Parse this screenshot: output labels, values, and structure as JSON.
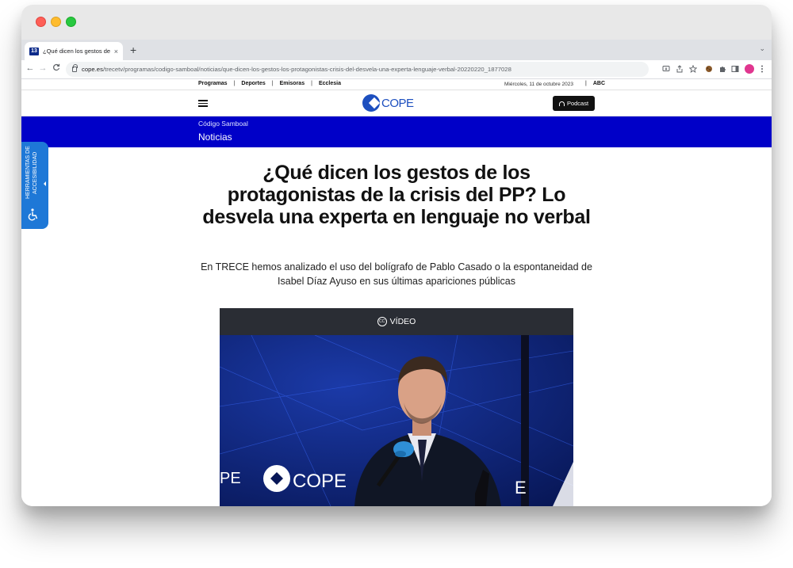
{
  "browser": {
    "tab_title": "¿Qué dicen los gestos de los protagonistas",
    "tab_favicon": "13",
    "tab_close": "×",
    "new_tab": "+",
    "tab_menu": "⌄",
    "url_host": "cope.es",
    "url_path": "/trecetv/programas/codigo-samboal/noticias/que-dicen-los-gestos-los-protagonistas-crisis-del-desvela-una-experta-lenguaje-verbal-20220220_1877028",
    "back": "←",
    "forward": "→",
    "reload": "C"
  },
  "topnav": {
    "links": [
      "Programas",
      "Deportes",
      "Emisoras",
      "Ecclesia"
    ],
    "separator": "|",
    "date": "Miércoles, 11 de octubre 2023",
    "abc": "ABC"
  },
  "header": {
    "logo_text": "COPE",
    "podcast_label": "Podcast"
  },
  "section": {
    "program": "Código Samboal",
    "category": "Noticias"
  },
  "accessibility": {
    "label": "HERRAMIENTAS DE ACCESIBILIDAD"
  },
  "article": {
    "headline": "¿Qué dicen los gestos de los protagonistas de la crisis del PP? Lo desvela una experta en lenguaje no verbal",
    "subhead": "En TRECE hemos analizado el uso del bolígrafo de Pablo Casado o la espontaneidad de Isabel Díaz Ayuso en sus últimas apariciones públicas"
  },
  "video": {
    "label": "VÍDEO",
    "backdrop_logo": "COPE",
    "backdrop_partial_left": "PE",
    "backdrop_partial_right": "E"
  },
  "colors": {
    "brand_blue": "#0000c8",
    "logo_blue": "#1d4fbf",
    "a11y_blue": "#1e78d7"
  }
}
